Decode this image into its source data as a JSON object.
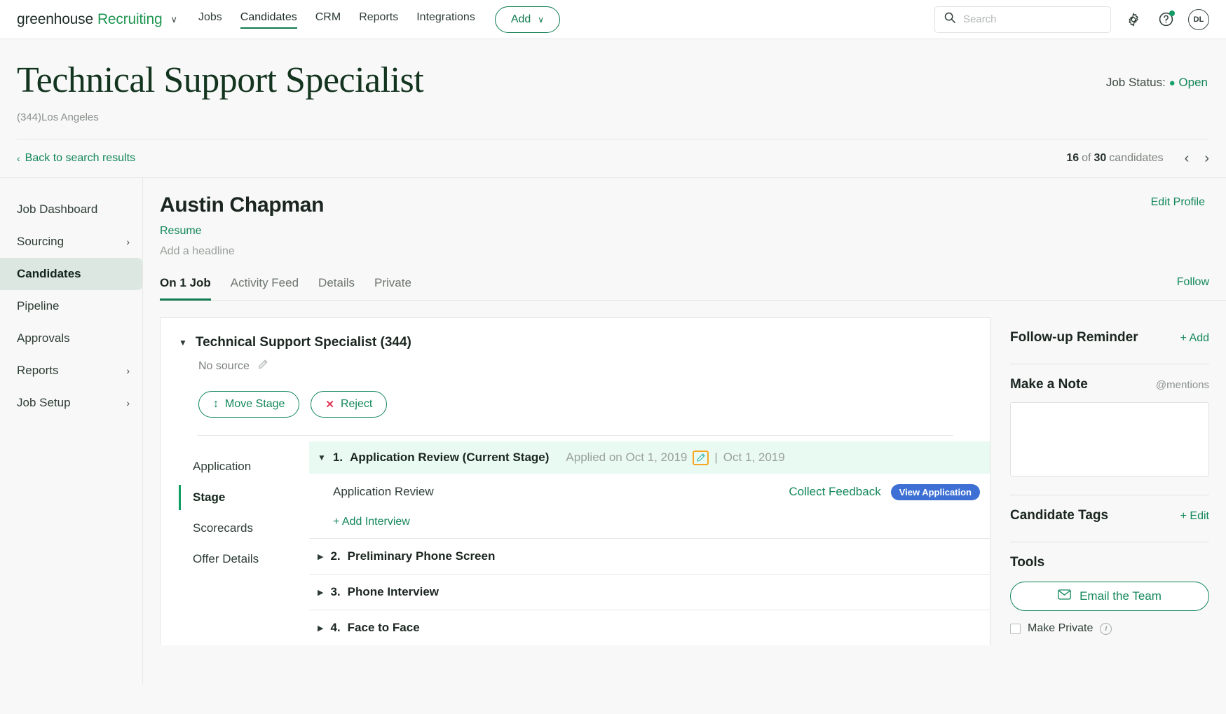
{
  "topnav": {
    "brand_primary": "greenhouse",
    "brand_secondary": "Recruiting",
    "brand_caret": "∨",
    "links": [
      {
        "label": "Jobs",
        "active": false
      },
      {
        "label": "Candidates",
        "active": true
      },
      {
        "label": "CRM",
        "active": false
      },
      {
        "label": "Reports",
        "active": false
      },
      {
        "label": "Integrations",
        "active": false
      }
    ],
    "add_label": "Add",
    "add_caret": "∨",
    "search_placeholder": "Search",
    "search_value": "",
    "avatar_initials": "DL"
  },
  "job": {
    "title": "Technical Support Specialist",
    "subtitle": "(344)Los Angeles",
    "status_label": "Job Status:",
    "status_dot": "●",
    "status_value": "Open",
    "back_label": "Back to search results",
    "back_chevron": "‹",
    "count_current": "16",
    "count_of": "of",
    "count_total": "30",
    "count_suffix": "candidates",
    "prev_icon": "‹",
    "next_icon": "›"
  },
  "sidebar": {
    "items": [
      {
        "label": "Job Dashboard",
        "chevron": "",
        "active": false
      },
      {
        "label": "Sourcing",
        "chevron": "›",
        "active": false
      },
      {
        "label": "Candidates",
        "chevron": "",
        "active": true
      },
      {
        "label": "Pipeline",
        "chevron": "",
        "active": false
      },
      {
        "label": "Approvals",
        "chevron": "",
        "active": false
      },
      {
        "label": "Reports",
        "chevron": "›",
        "active": false
      },
      {
        "label": "Job Setup",
        "chevron": "›",
        "active": false
      }
    ]
  },
  "candidate": {
    "name": "Austin Chapman",
    "resume_link": "Resume",
    "headline_placeholder": "Add a headline",
    "edit_profile": "Edit Profile",
    "follow": "Follow",
    "tabs": [
      {
        "label": "On 1 Job",
        "active": true
      },
      {
        "label": "Activity Feed",
        "active": false
      },
      {
        "label": "Details",
        "active": false
      },
      {
        "label": "Private",
        "active": false
      }
    ]
  },
  "card": {
    "collapse_icon": "▼",
    "title": "Technical Support Specialist (344)",
    "source_label": "No source",
    "source_edit_icon": "pencil-icon",
    "move_stage_label": "Move Stage",
    "move_stage_icon": "↕",
    "reject_label": "Reject",
    "reject_icon": "✕",
    "stage_nav": [
      {
        "label": "Application",
        "active": false
      },
      {
        "label": "Stage",
        "active": true
      },
      {
        "label": "Scorecards",
        "active": false
      },
      {
        "label": "Offer Details",
        "active": false
      }
    ],
    "current_stage": {
      "expand_icon": "▼",
      "number": "1.",
      "name": "Application Review (Current Stage)",
      "applied_text": "Applied on Oct 1, 2019",
      "edit_icon": "pencil-icon",
      "divider": "|",
      "date": "Oct 1, 2019"
    },
    "interview": {
      "name": "Application Review",
      "collect_feedback": "Collect Feedback",
      "view_application": "View Application"
    },
    "add_interview": "+ Add Interview",
    "stages": [
      {
        "expand_icon": "▶",
        "number": "2.",
        "name": "Preliminary Phone Screen"
      },
      {
        "expand_icon": "▶",
        "number": "3.",
        "name": "Phone Interview"
      },
      {
        "expand_icon": "▶",
        "number": "4.",
        "name": "Face to Face"
      }
    ]
  },
  "rail": {
    "followup_title": "Follow-up Reminder",
    "followup_action": "+ Add",
    "note_title": "Make a Note",
    "note_mentions": "@mentions",
    "note_value": "",
    "tags_title": "Candidate Tags",
    "tags_action": "+ Edit",
    "tools_title": "Tools",
    "email_team": "Email the Team",
    "make_private": "Make Private",
    "info_icon": "i"
  },
  "colors": {
    "accent_green": "#13875a",
    "brand_green": "#219653",
    "reject_red": "#e0395a",
    "view_app_blue": "#3d6fd4",
    "focus_orange": "#f5a623",
    "current_stage_bg": "#e9faf2"
  }
}
